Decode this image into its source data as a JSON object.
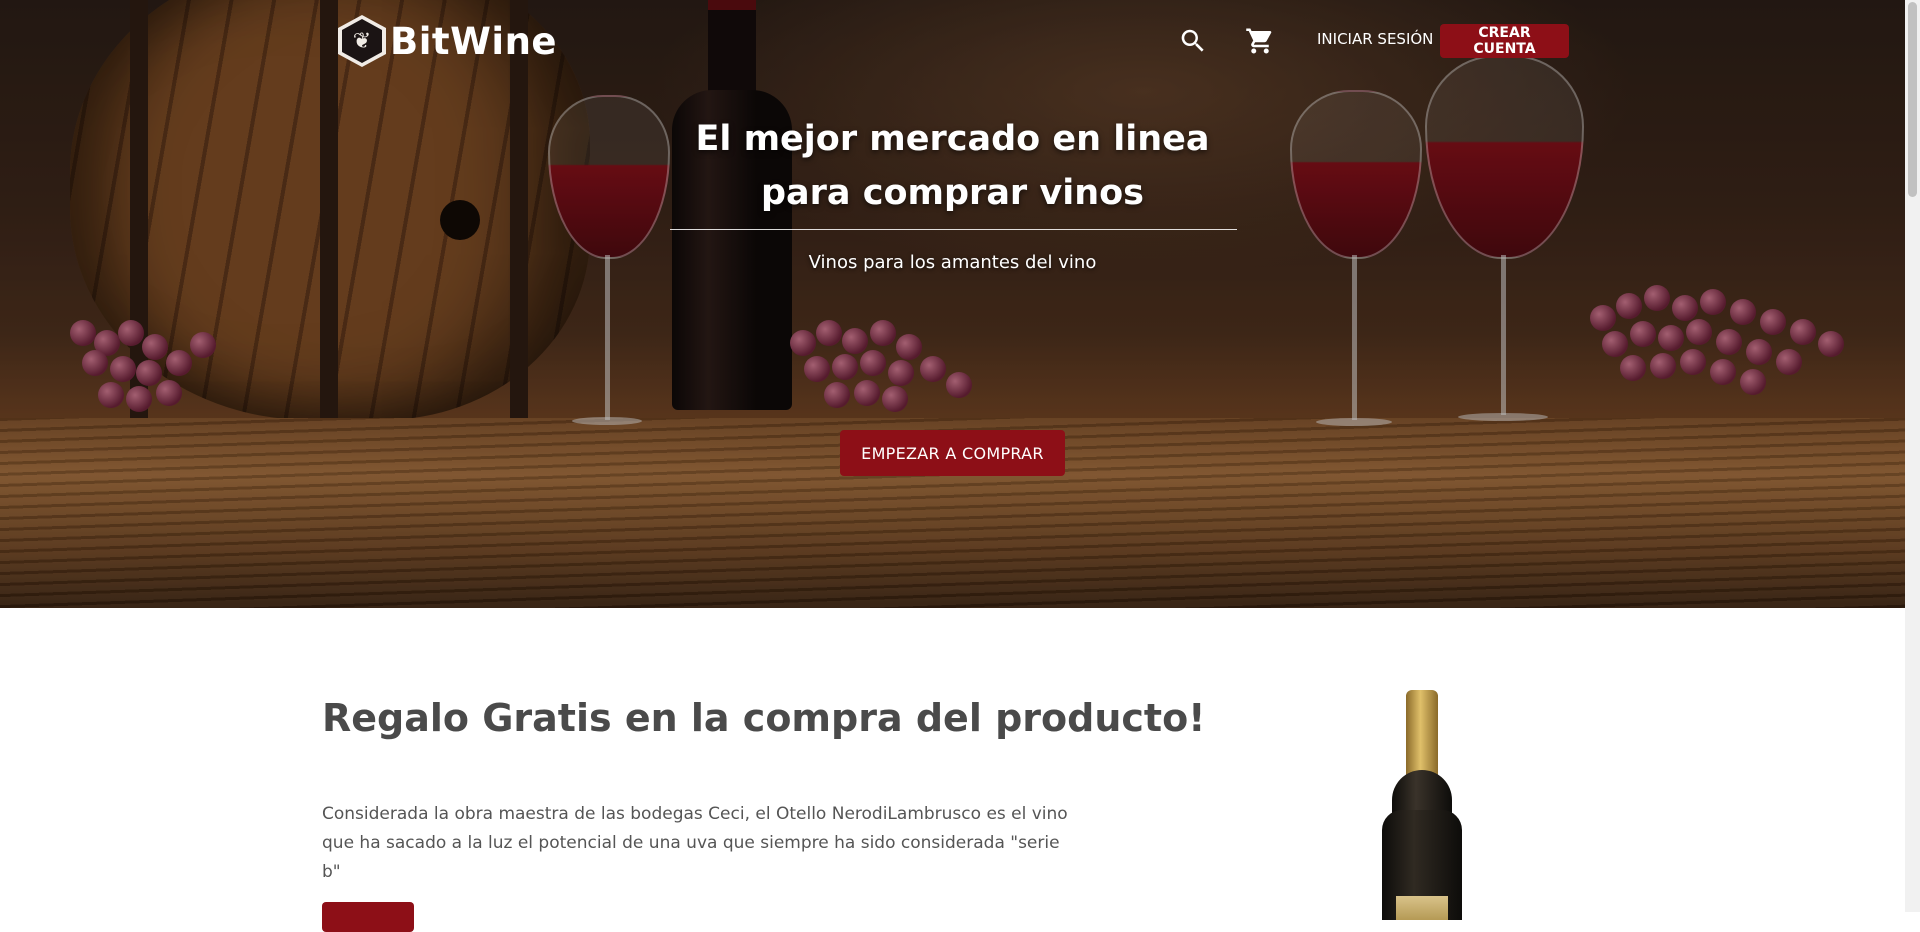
{
  "header": {
    "logo_text": "BitWine",
    "logo_icon": "grape-leaf-icon",
    "search_icon": "search-icon",
    "cart_icon": "cart-icon",
    "login_label": "INICIAR SESIÓN",
    "signup_label": "CREAR CUENTA"
  },
  "hero": {
    "title": "El mejor mercado en linea para comprar vinos",
    "subtitle": "Vinos para los amantes del vino",
    "cta_label": "EMPEZAR A COMPRAR"
  },
  "promo": {
    "title": "Regalo Gratis en la compra del producto!",
    "text": "Considerada la obra maestra de las bodegas Ceci, el Otello NerodiLambrusco es el vino que ha sacado a la luz el potencial de una uva que siempre ha sido considerada \"serie b\""
  },
  "colors": {
    "accent": "#8d0f17",
    "text_dark": "#4a4a4a"
  }
}
